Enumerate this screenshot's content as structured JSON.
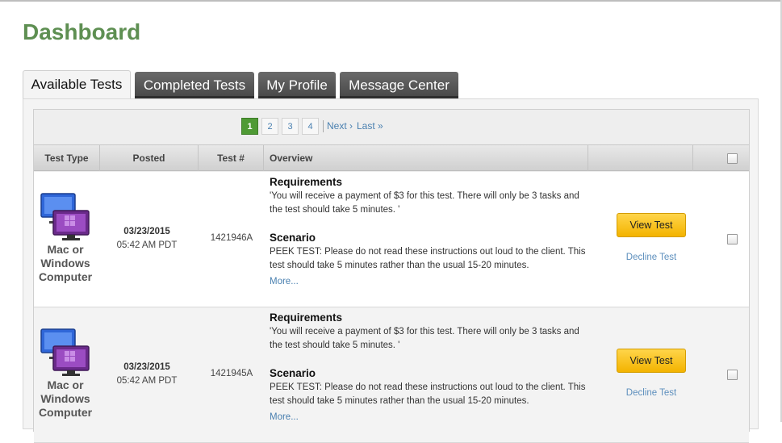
{
  "page": {
    "title": "Dashboard"
  },
  "tabs": [
    {
      "label": "Available Tests",
      "active": true
    },
    {
      "label": "Completed Tests",
      "active": false
    },
    {
      "label": "My Profile",
      "active": false
    },
    {
      "label": "Message Center",
      "active": false
    }
  ],
  "pagination": {
    "pages": [
      "1",
      "2",
      "3",
      "4"
    ],
    "current": "1",
    "next_label": "Next ›",
    "last_label": "Last »"
  },
  "table": {
    "columns": [
      "Test Type",
      "Posted",
      "Test #",
      "Overview"
    ],
    "rows": [
      {
        "device_label": "Mac or Windows Computer",
        "date": "03/23/2015",
        "time": "05:42 AM PDT",
        "test_number": "1421946A",
        "requirements_heading": "Requirements",
        "requirements_text": "'You will receive a payment of $3 for this test. There will only be 3 tasks and the test should take 5 minutes. '",
        "scenario_heading": "Scenario",
        "scenario_text": "PEEK TEST: Please do not read these instructions out loud to the client. This test should take 5 minutes rather than the usual 15-20 minutes.",
        "more_label": "More...",
        "view_label": "View Test",
        "decline_label": "Decline Test"
      },
      {
        "device_label": "Mac or Windows Computer",
        "date": "03/23/2015",
        "time": "05:42 AM PDT",
        "test_number": "1421945A",
        "requirements_heading": "Requirements",
        "requirements_text": "'You will receive a payment of $3 for this test. There will only be 3 tasks and the test should take 5 minutes. '",
        "scenario_heading": "Scenario",
        "scenario_text": "PEEK TEST: Please do not read these instructions out loud to the client. This test should take 5 minutes rather than the usual 15-20 minutes.",
        "more_label": "More...",
        "view_label": "View Test",
        "decline_label": "Decline Test"
      }
    ]
  },
  "icons": {
    "device": "mac-windows-computer-icon"
  },
  "colors": {
    "title_green": "#5e8f52",
    "current_page": "#4f9a35",
    "view_button": "#f3b300",
    "link_blue": "#4a80b0",
    "tab_dark": "#4a4a4a"
  }
}
